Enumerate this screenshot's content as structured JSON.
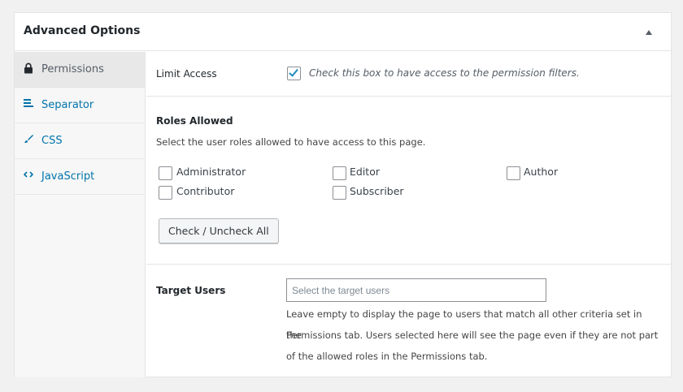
{
  "panel": {
    "title": "Advanced Options",
    "toggle_icon": "triangle-up-icon"
  },
  "tabs": [
    {
      "label": "Permissions",
      "icon": "lock-icon",
      "active": true
    },
    {
      "label": "Separator",
      "icon": "separator-icon",
      "active": false
    },
    {
      "label": "CSS",
      "icon": "brush-icon",
      "active": false
    },
    {
      "label": "JavaScript",
      "icon": "code-icon",
      "active": false
    }
  ],
  "limit_access": {
    "label": "Limit Access",
    "checked": true,
    "description": "Check this box to have access to the permission filters."
  },
  "roles": {
    "heading": "Roles Allowed",
    "description": "Select the user roles allowed to have access to this page.",
    "options": [
      {
        "label": "Administrator",
        "checked": false
      },
      {
        "label": "Editor",
        "checked": false
      },
      {
        "label": "Author",
        "checked": false
      },
      {
        "label": "Contributor",
        "checked": false
      },
      {
        "label": "Subscriber",
        "checked": false
      }
    ],
    "toggle_all_label": "Check / Uncheck All"
  },
  "target_users": {
    "label": "Target Users",
    "placeholder": "Select the target users",
    "value": "",
    "help_lines": [
      "Leave empty to display the page to users that match all other criteria set in the",
      "Permissions tab. Users selected here will see the page even if they are not part",
      "of the allowed roles in the Permissions tab."
    ]
  },
  "colors": {
    "accent": "#0073aa",
    "check": "#1e8cbe",
    "background": "#f1f1f1"
  }
}
